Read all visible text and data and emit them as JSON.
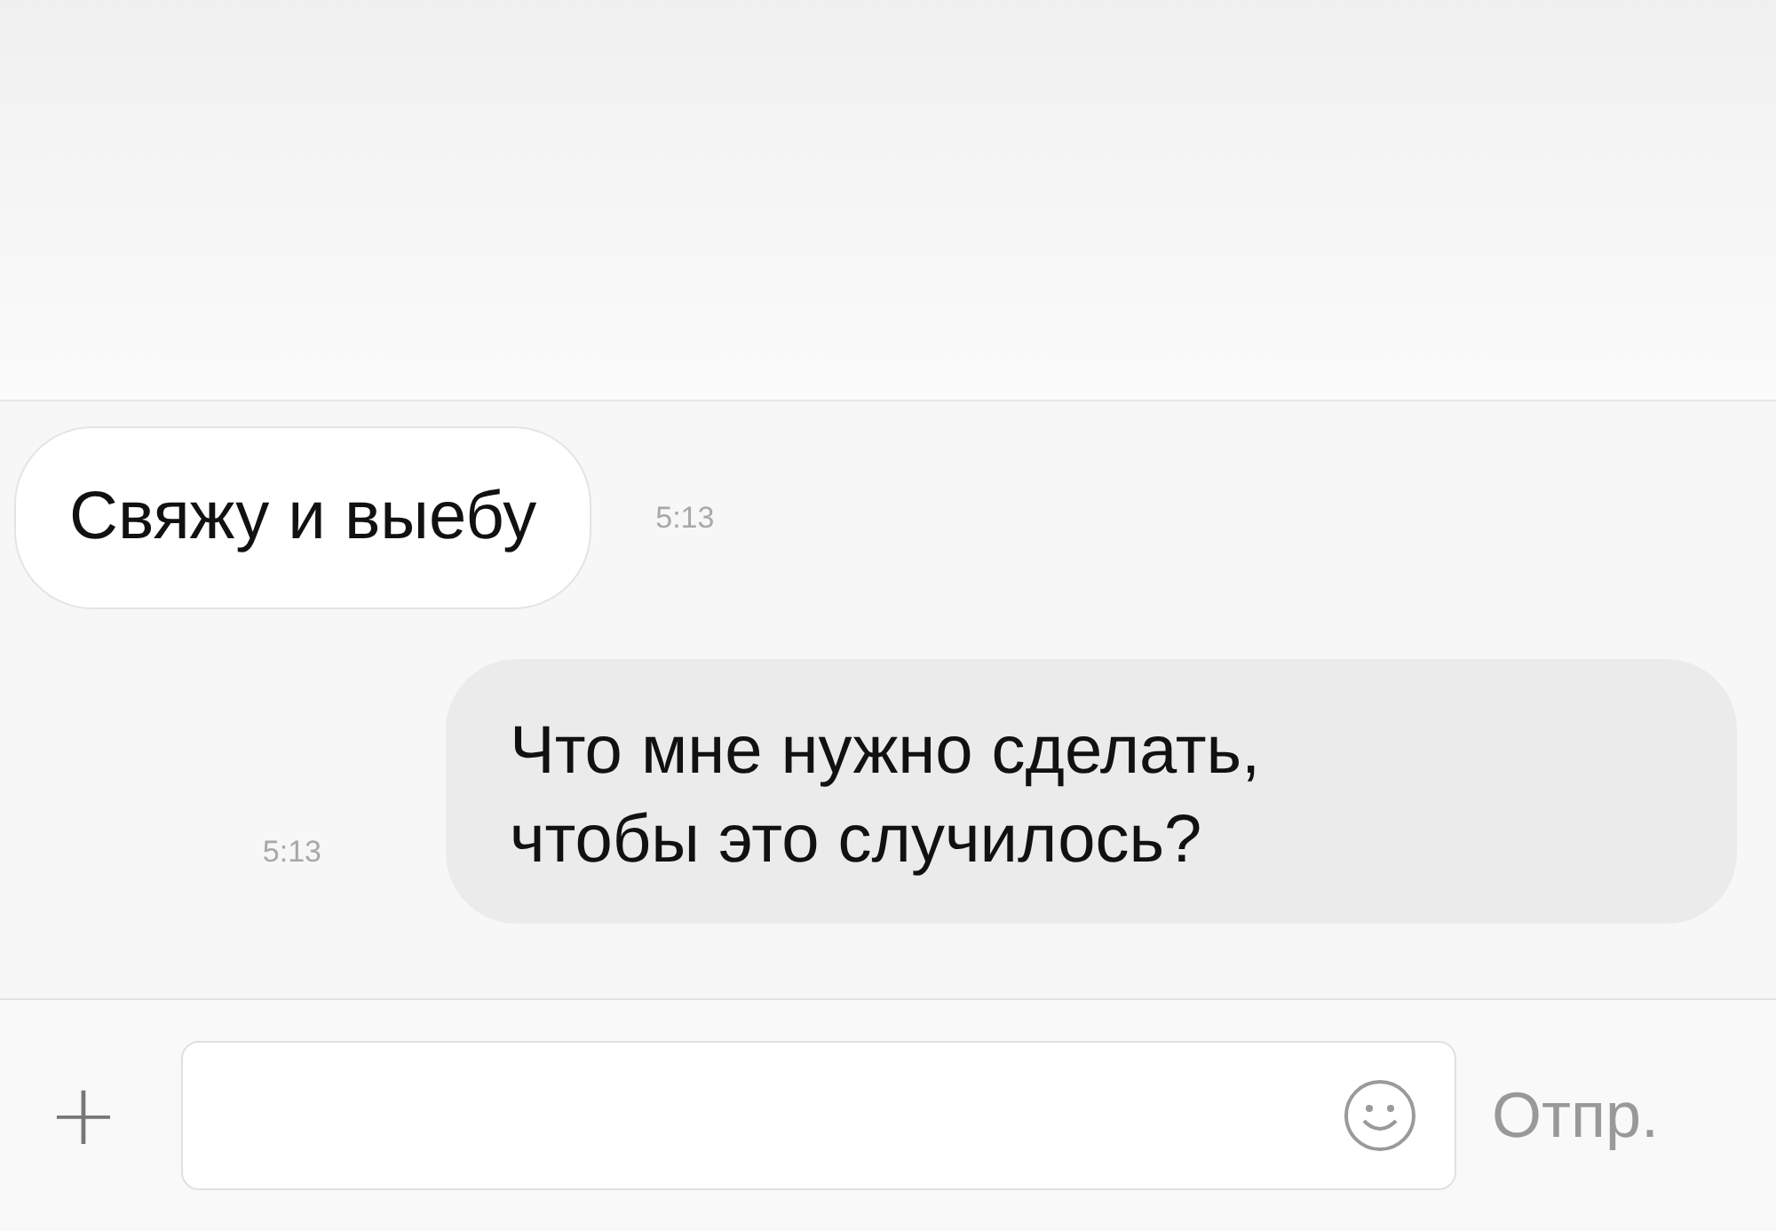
{
  "messages": [
    {
      "text": "Свяжу и выебу",
      "time": "5:13",
      "outgoing": false
    },
    {
      "text": "Что мне нужно сделать, чтобы это случилось?",
      "time": "5:13",
      "outgoing": true
    }
  ],
  "composer": {
    "add": "+",
    "send": "Отпр."
  }
}
